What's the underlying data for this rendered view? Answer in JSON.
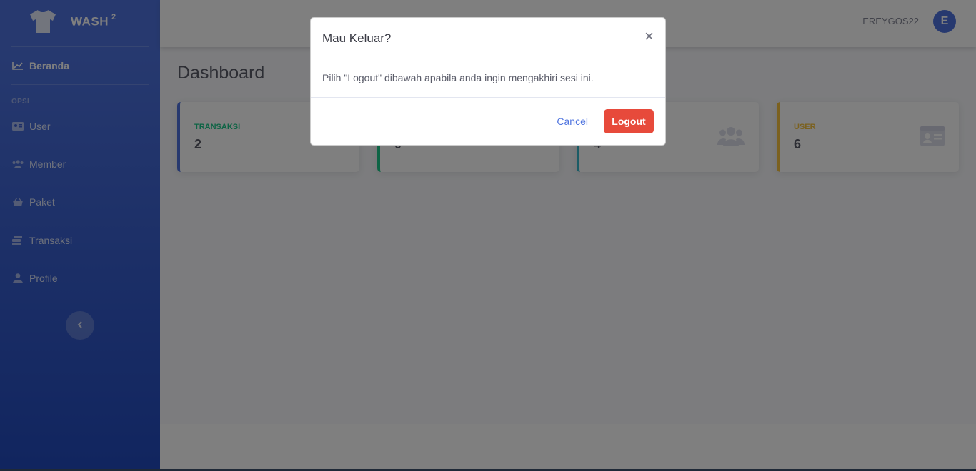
{
  "brand": {
    "name": "WASH",
    "superscript": "2"
  },
  "sidebar": {
    "active_item": {
      "label": "Beranda"
    },
    "heading": "OPSI",
    "items": [
      {
        "label": "User"
      },
      {
        "label": "Member"
      },
      {
        "label": "Paket"
      },
      {
        "label": "Transaksi"
      },
      {
        "label": "Profile"
      }
    ]
  },
  "topbar": {
    "username": "EREYGOS22",
    "avatar_initial": "E"
  },
  "page": {
    "title": "Dashboard"
  },
  "cards": [
    {
      "label": "TRANSAKSI",
      "value": "2",
      "color": "#1cc88a",
      "border": "#4e73df"
    },
    {
      "label": "",
      "value": "0",
      "color": "#1cc88a",
      "border": "#1cc88a"
    },
    {
      "label": "",
      "value": "4",
      "color": "#36b9cc",
      "border": "#36b9cc",
      "icon": "users-icon"
    },
    {
      "label": "USER",
      "value": "6",
      "color": "#f6c23e",
      "border": "#f6c23e",
      "icon": "id-card-icon"
    }
  ],
  "modal": {
    "title": "Mau Keluar?",
    "close_glyph": "×",
    "body": "Pilih \"Logout\" dibawah apabila anda ingin mengakhiri sesi ini.",
    "cancel_label": "Cancel",
    "logout_label": "Logout"
  }
}
